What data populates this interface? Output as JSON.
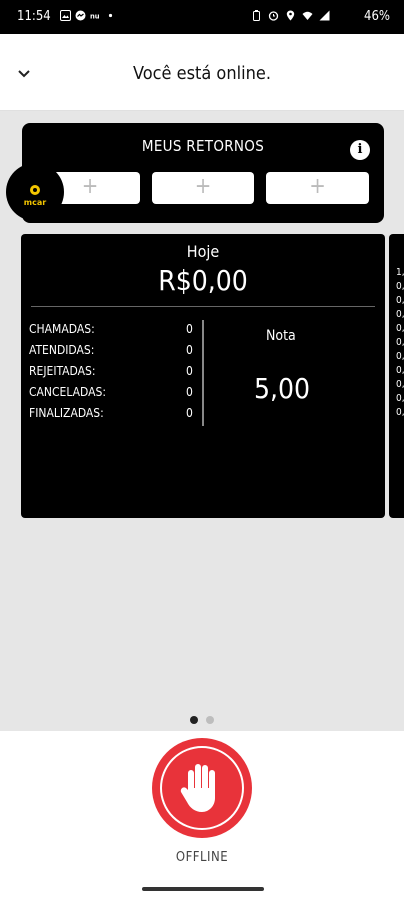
{
  "status_bar": {
    "time": "11:54",
    "battery": "46%"
  },
  "header": {
    "title": "Você está online."
  },
  "retornos": {
    "title": "MEUS RETORNOS",
    "slots": [
      "+",
      "+",
      "+"
    ]
  },
  "avatar": {
    "logo_text": "mcar"
  },
  "stats": {
    "period": "Hoje",
    "amount": "R$0,00",
    "rows": [
      {
        "label": "CHAMADAS:",
        "value": "0"
      },
      {
        "label": "ATENDIDAS:",
        "value": "0"
      },
      {
        "label": "REJEITADAS:",
        "value": "0"
      },
      {
        "label": "CANCELADAS:",
        "value": "0"
      },
      {
        "label": "FINALIZADAS:",
        "value": "0"
      }
    ],
    "rating_label": "Nota",
    "rating_value": "5,00"
  },
  "peek_card": {
    "values": [
      "1,",
      "0,",
      "0,",
      "0,",
      "0,",
      "0,",
      "0,",
      "0,",
      "0,",
      "0,",
      "0,"
    ]
  },
  "pager": {
    "total": 2,
    "active": 1
  },
  "bottom": {
    "offline_label": "OFFLINE"
  },
  "colors": {
    "offline_red": "#e8333a",
    "brand_yellow": "#f3c500"
  }
}
